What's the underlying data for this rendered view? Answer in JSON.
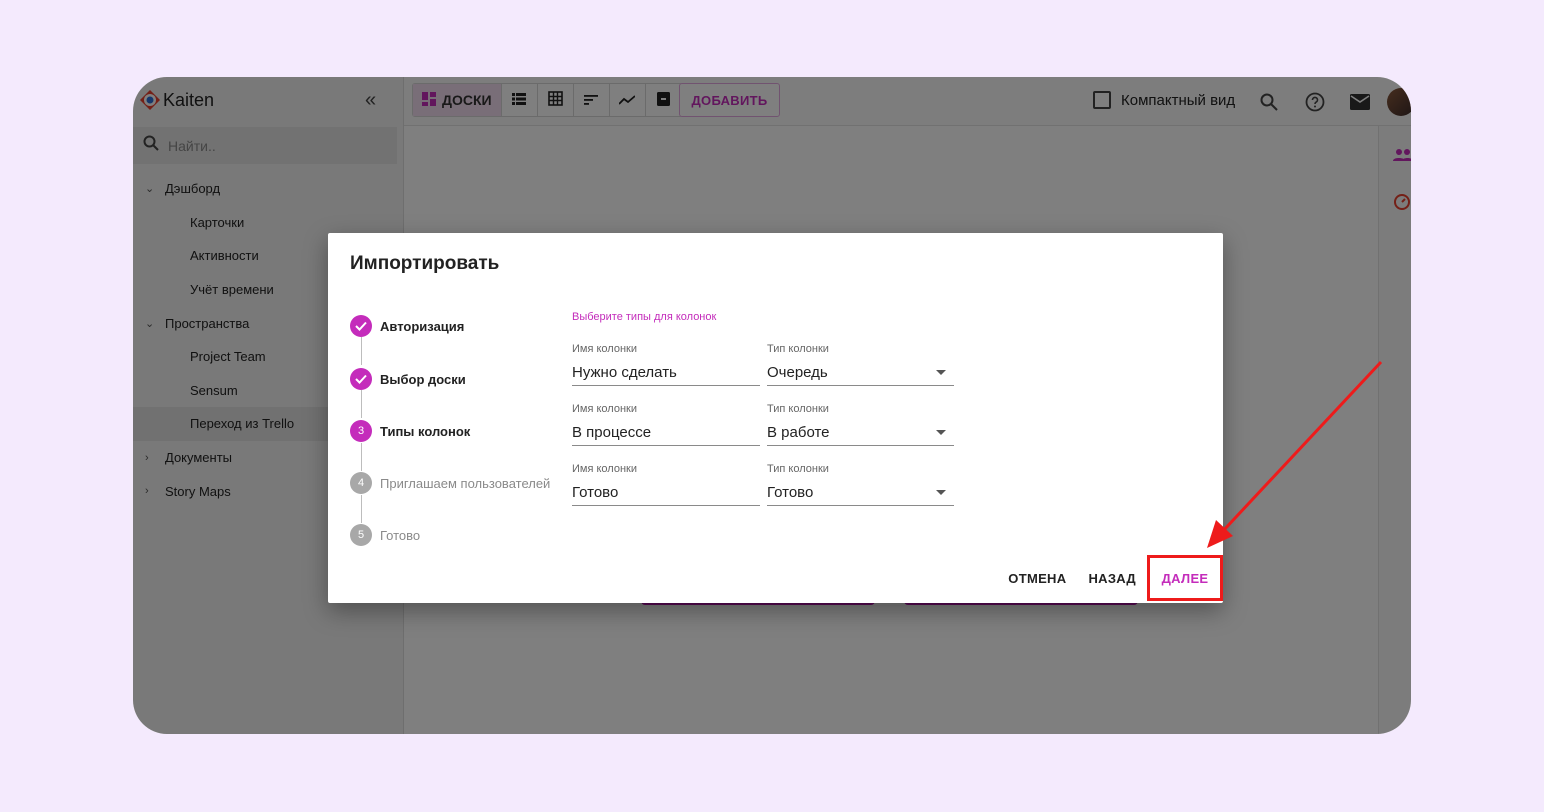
{
  "app": {
    "name": "Kaiten",
    "collapse_glyph": "«"
  },
  "search": {
    "placeholder": "Найти.."
  },
  "sidebar": {
    "items": [
      {
        "label": "Дэшборд",
        "level": "top",
        "caret": "⌄"
      },
      {
        "label": "Карточки",
        "level": "sub"
      },
      {
        "label": "Активности",
        "level": "sub"
      },
      {
        "label": "Учёт времени",
        "level": "sub"
      },
      {
        "label": "Пространства",
        "level": "top",
        "caret": "⌄"
      },
      {
        "label": "Project Team",
        "level": "sub"
      },
      {
        "label": "Sensum",
        "level": "sub"
      },
      {
        "label": "Переход из Trello",
        "level": "sub",
        "active": true
      },
      {
        "label": "Документы",
        "level": "top",
        "caret": "›"
      },
      {
        "label": "Story Maps",
        "level": "top",
        "caret": "›"
      }
    ]
  },
  "toolbar": {
    "boards_label": "ДОСКИ",
    "add_label": "ДОБАВИТЬ",
    "compact_label": "Компактный вид",
    "view_icons": [
      "list-view-icon",
      "table-view-icon",
      "sort-icon",
      "chart-icon",
      "archive-icon"
    ]
  },
  "dialog": {
    "title": "Импортировать",
    "hint": "Выберите типы для колонок",
    "steps": [
      {
        "number": "",
        "label": "Авторизация",
        "state": "done"
      },
      {
        "number": "",
        "label": "Выбор доски",
        "state": "done"
      },
      {
        "number": "3",
        "label": "Типы колонок",
        "state": "current"
      },
      {
        "number": "4",
        "label": "Приглашаем пользователей",
        "state": "pending"
      },
      {
        "number": "5",
        "label": "Готово",
        "state": "pending"
      }
    ],
    "column_name_label": "Имя колонки",
    "column_type_label": "Тип колонки",
    "rows": [
      {
        "name": "Нужно сделать",
        "type": "Очередь"
      },
      {
        "name": "В процессе",
        "type": "В работе"
      },
      {
        "name": "Готово",
        "type": "Готово"
      }
    ],
    "cancel_label": "ОТМЕНА",
    "back_label": "НАЗАД",
    "next_label": "ДАЛЕЕ"
  },
  "colors": {
    "accent": "#c42cbb",
    "highlight": "#ee1b1b",
    "background": "#f4eafd"
  }
}
